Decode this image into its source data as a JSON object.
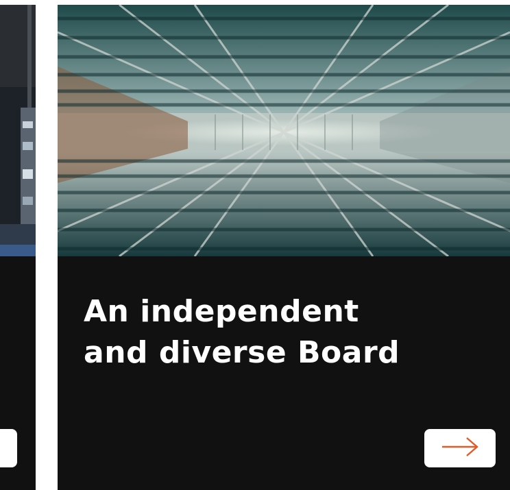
{
  "cards": [
    {
      "id": "partial-card",
      "title": ""
    },
    {
      "id": "board-card",
      "title_line1": "An independent",
      "title_line2": "and diverse Board",
      "button_icon": "arrow-right-icon",
      "accent_color": "#e35a2a"
    }
  ]
}
